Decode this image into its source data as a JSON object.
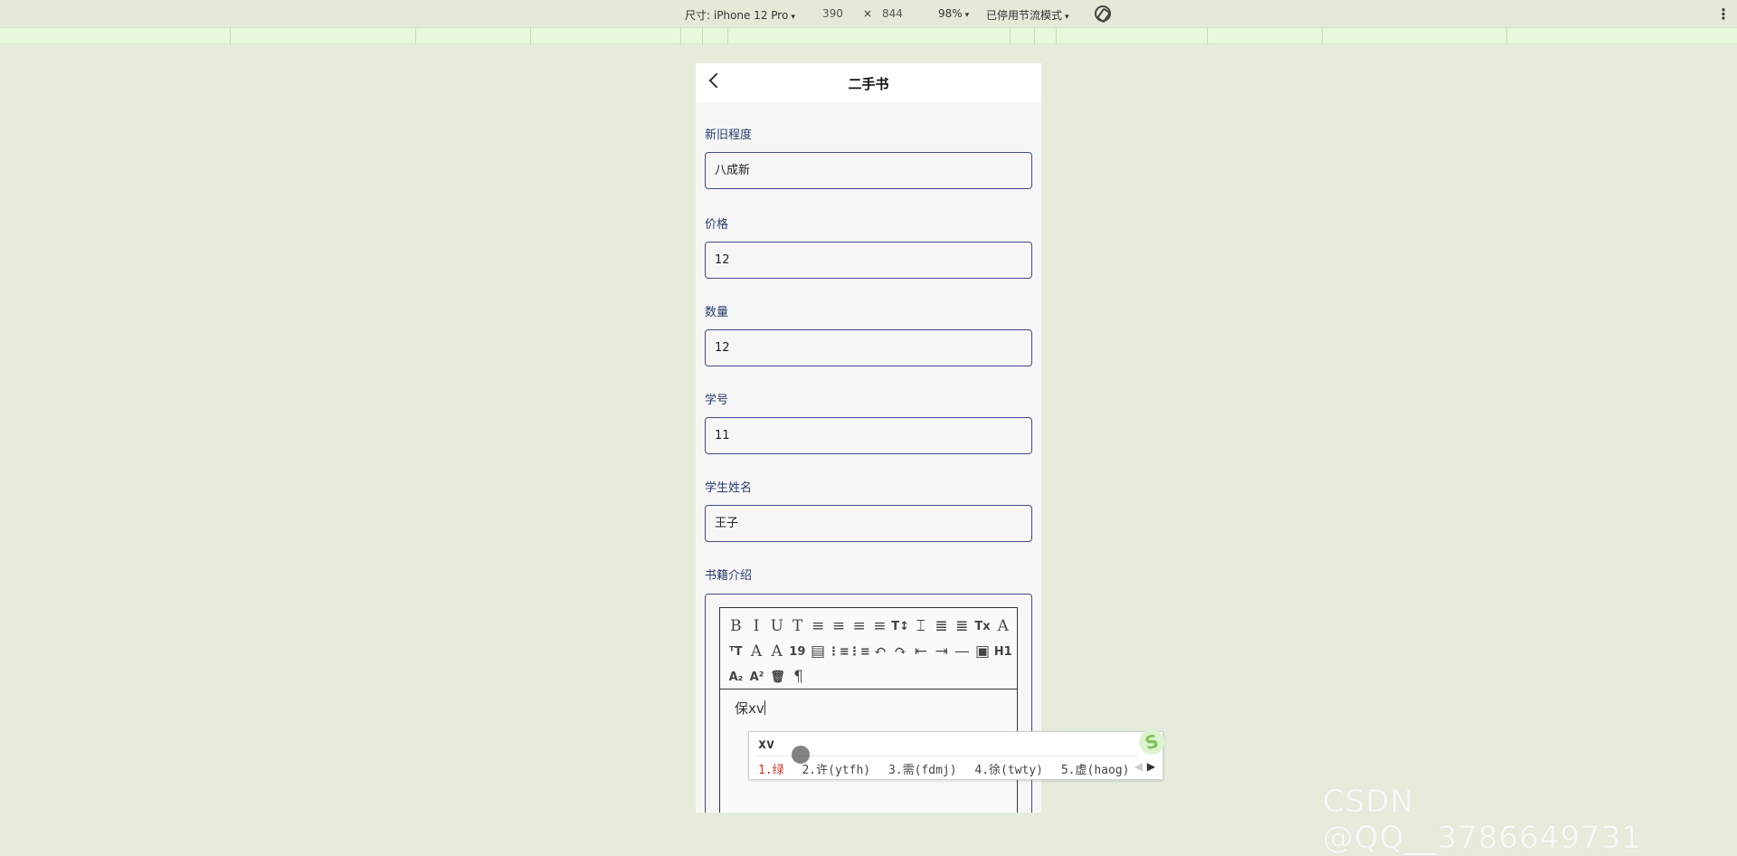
{
  "devtools": {
    "device_label": "尺寸: iPhone 12 Pro",
    "width": "390",
    "times": "×",
    "height": "844",
    "zoom": "98%",
    "throttle": "已停用节流模式",
    "caret": "▾"
  },
  "nav": {
    "title": "二手书"
  },
  "form": {
    "fields": [
      {
        "label": "新旧程度",
        "value": "八成新"
      },
      {
        "label": "价格",
        "value": "12"
      },
      {
        "label": "数量",
        "value": "12"
      },
      {
        "label": "学号",
        "value": "11"
      },
      {
        "label": "学生姓名",
        "value": "王子"
      }
    ],
    "intro_label": "书籍介绍"
  },
  "editor": {
    "content": "保xv",
    "toolbar_row1": [
      "B",
      "I",
      "U",
      "T",
      "≡",
      "≡",
      "≡",
      "≡",
      "T↕",
      "⌶",
      "≣",
      "≣",
      "Tx",
      "A"
    ],
    "toolbar_row2": [
      "ᵀT",
      "A",
      "A",
      "19",
      "▤",
      "⋮≡",
      "⋮≡",
      "↶",
      "↷",
      "⇤",
      "⇥",
      "—",
      "▣",
      "H1"
    ],
    "toolbar_row3": [
      "A₂",
      "A²",
      "🗑",
      "¶"
    ]
  },
  "ime": {
    "composition": "xv",
    "candidates": [
      "1.绿",
      "2.许(ytfh)",
      "3.需(fdmj)",
      "4.徐(twty)",
      "5.虚(haog)"
    ],
    "next": "▶",
    "prev": "◀",
    "logo": "S"
  },
  "watermark": "CSDN @QQ__3786649731"
}
